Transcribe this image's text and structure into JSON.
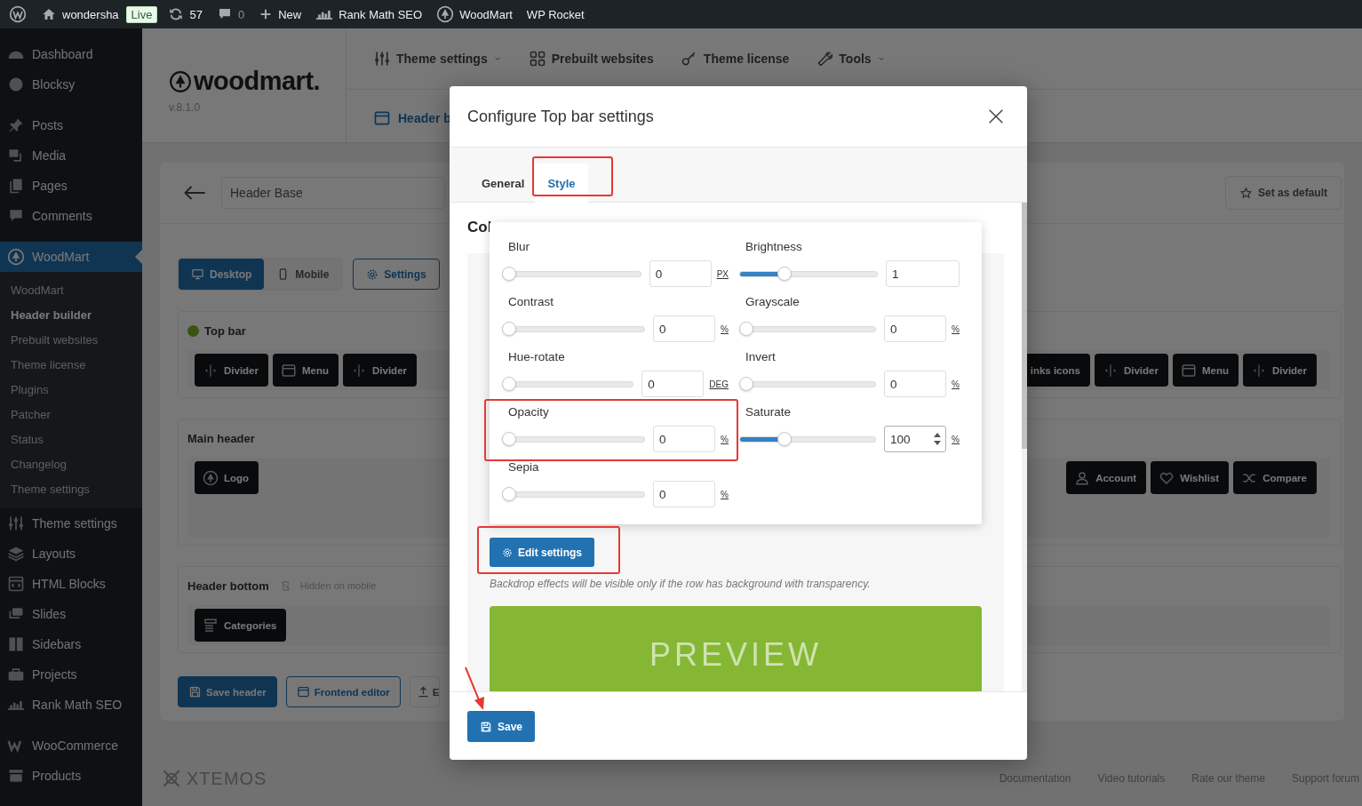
{
  "admin_bar": {
    "site_name": "wondersha",
    "live_badge": "Live",
    "updates_count": "57",
    "comments_count": "0",
    "new_label": "New",
    "links": [
      "Rank Math SEO",
      "WoodMart",
      "WP Rocket"
    ]
  },
  "sidebar": {
    "groups": [
      [
        {
          "label": "Dashboard",
          "selected": false
        },
        {
          "label": "Blocksy",
          "selected": false
        }
      ],
      [
        {
          "label": "Posts",
          "selected": false
        },
        {
          "label": "Media",
          "selected": false
        },
        {
          "label": "Pages",
          "selected": false
        },
        {
          "label": "Comments",
          "selected": false
        }
      ],
      [
        {
          "label": "WoodMart",
          "selected": true,
          "children": [
            {
              "label": "WoodMart",
              "selected": false
            },
            {
              "label": "Header builder",
              "selected": true
            },
            {
              "label": "Prebuilt websites",
              "selected": false
            },
            {
              "label": "Theme license",
              "selected": false
            },
            {
              "label": "Plugins",
              "selected": false
            },
            {
              "label": "Patcher",
              "selected": false
            },
            {
              "label": "Status",
              "selected": false
            },
            {
              "label": "Changelog",
              "selected": false
            },
            {
              "label": "Theme settings",
              "selected": false
            }
          ]
        },
        {
          "label": "Theme settings",
          "selected": false
        },
        {
          "label": "Layouts",
          "selected": false
        },
        {
          "label": "HTML Blocks",
          "selected": false
        },
        {
          "label": "Slides",
          "selected": false
        },
        {
          "label": "Sidebars",
          "selected": false
        },
        {
          "label": "Projects",
          "selected": false
        },
        {
          "label": "Rank Math SEO",
          "selected": false
        }
      ],
      [
        {
          "label": "WooCommerce",
          "selected": false
        },
        {
          "label": "Products",
          "selected": false
        }
      ]
    ]
  },
  "theme_header": {
    "logo_text": "woodmart.",
    "version": "v.8.1.0",
    "nav": [
      {
        "label": "Theme settings",
        "dropdown": true
      },
      {
        "label": "Prebuilt websites",
        "dropdown": false
      },
      {
        "label": "Theme license",
        "dropdown": false
      },
      {
        "label": "Tools",
        "dropdown": true
      }
    ],
    "subnav_tab": "Header b"
  },
  "builder": {
    "header_name": "Header Base",
    "set_default_button": "Set as default",
    "device_tabs": [
      {
        "label": "Desktop",
        "selected": true
      },
      {
        "label": "Mobile",
        "selected": false
      }
    ],
    "settings_button": "Settings",
    "rows": [
      {
        "title": "Top bar",
        "status_dot": true,
        "left": [
          {
            "label": "Divider",
            "kind": "divider"
          },
          {
            "label": "Menu",
            "kind": "menu"
          },
          {
            "label": "Divider",
            "kind": "divider"
          }
        ],
        "right": [
          {
            "label": "inks icons",
            "kind": "text"
          },
          {
            "label": "Divider",
            "kind": "divider"
          },
          {
            "label": "Menu",
            "kind": "menu"
          },
          {
            "label": "Divider",
            "kind": "divider"
          }
        ]
      },
      {
        "title": "Main header",
        "status_dot": false,
        "left": [
          {
            "label": "Logo",
            "kind": "logo"
          }
        ],
        "right": [
          {
            "label": "Account",
            "kind": "account"
          },
          {
            "label": "Wishlist",
            "kind": "wishlist"
          },
          {
            "label": "Compare",
            "kind": "compare"
          }
        ]
      },
      {
        "title": "Header bottom",
        "status_dot": false,
        "note": "Hidden on mobile",
        "left": [
          {
            "label": "Categories",
            "kind": "categories"
          }
        ],
        "right": []
      }
    ],
    "actions": [
      {
        "label": "Save header",
        "kind": "primary"
      },
      {
        "label": "Frontend editor",
        "kind": "outline"
      },
      {
        "label": "E",
        "kind": "plain"
      }
    ]
  },
  "footer": {
    "brand": "XTEMOS",
    "links": [
      "Documentation",
      "Video tutorials",
      "Rate our theme",
      "Support forum"
    ]
  },
  "modal": {
    "title": "Configure Top bar settings",
    "tabs": [
      {
        "label": "General",
        "selected": false
      },
      {
        "label": "Style",
        "selected": true
      }
    ],
    "section_title": "Col",
    "filters": [
      {
        "label": "Blur",
        "value": "0",
        "unit": "PX",
        "level": 0,
        "focused": false
      },
      {
        "label": "Brightness",
        "value": "1",
        "level": 0.31,
        "focused": false
      },
      {
        "label": "Contrast",
        "value": "0",
        "unit": "%",
        "level": 0,
        "focused": false
      },
      {
        "label": "Grayscale",
        "value": "0",
        "unit": "%",
        "level": 0,
        "focused": false
      },
      {
        "label": "Hue-rotate",
        "value": "0",
        "unit": "DEG",
        "level": 0,
        "focused": false
      },
      {
        "label": "Invert",
        "value": "0",
        "unit": "%",
        "level": 0,
        "focused": false
      },
      {
        "label": "Opacity",
        "value": "0",
        "unit": "%",
        "level": 0,
        "focused": false
      },
      {
        "label": "Saturate",
        "value": "100",
        "unit": "%",
        "level": 0.31,
        "focused": true
      },
      {
        "label": "Sepia",
        "value": "0",
        "unit": "%",
        "level": 0,
        "focused": false
      }
    ],
    "edit_button": "Edit settings",
    "note": "Backdrop effects will be visible only if the row has background with transparency.",
    "preview_label": "PREVIEW",
    "save_button": "Save"
  }
}
